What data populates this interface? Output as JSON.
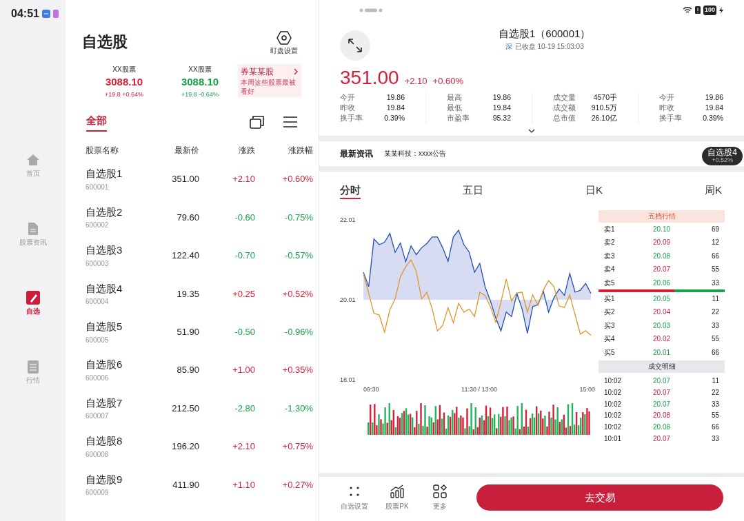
{
  "status_bar": {
    "time": "04:51",
    "battery": "100"
  },
  "sidebar": {
    "items": [
      {
        "label": "首页",
        "selected": false,
        "kind": "home"
      },
      {
        "label": "股票资讯",
        "selected": false,
        "kind": "news"
      },
      {
        "label": "自选",
        "selected": true,
        "kind": "watch"
      },
      {
        "label": "行情",
        "selected": false,
        "kind": "market"
      }
    ]
  },
  "watchlist": {
    "title": "自选股",
    "settings_label": "盯盘设置",
    "indices": [
      {
        "name": "XX股票",
        "value": "3088.10",
        "change": "+19.8 +0.64%",
        "rising": true
      },
      {
        "name": "XX股票",
        "value": "3088.10",
        "change": "+19.8 -0.64%",
        "rising": false
      }
    ],
    "promo": {
      "title": "券某某股",
      "text": "本周这些股票最被看好"
    },
    "tabs": [
      {
        "label": "全部",
        "selected": true
      }
    ],
    "columns": [
      "股票名称",
      "最新价",
      "涨跌",
      "涨跌幅"
    ],
    "rows": [
      {
        "name": "自选股1",
        "code": "600001",
        "price": "351.00",
        "change": "+2.10",
        "percent": "+0.60%",
        "rising": true
      },
      {
        "name": "自选股2",
        "code": "600002",
        "price": "79.60",
        "change": "-0.60",
        "percent": "-0.75%",
        "rising": false
      },
      {
        "name": "自选股3",
        "code": "600003",
        "price": "122.40",
        "change": "-0.70",
        "percent": "-0.57%",
        "rising": false
      },
      {
        "name": "自选股4",
        "code": "600004",
        "price": "19.35",
        "change": "+0.25",
        "percent": "+0.52%",
        "rising": true
      },
      {
        "name": "自选股5",
        "code": "600005",
        "price": "51.90",
        "change": "-0.50",
        "percent": "-0.96%",
        "rising": false
      },
      {
        "name": "自选股6",
        "code": "600006",
        "price": "85.90",
        "change": "+1.00",
        "percent": "+0.35%",
        "rising": true
      },
      {
        "name": "自选股7",
        "code": "600007",
        "price": "212.50",
        "change": "-2.80",
        "percent": "-1.30%",
        "rising": false
      },
      {
        "name": "自选股8",
        "code": "600008",
        "price": "196.20",
        "change": "+2.10",
        "percent": "+0.75%",
        "rising": true
      },
      {
        "name": "自选股9",
        "code": "600009",
        "price": "411.90",
        "change": "+1.10",
        "percent": "+0.27%",
        "rising": true
      }
    ]
  },
  "detail": {
    "title": "自选股1（600001）",
    "market": "深",
    "status": "已收盘 10-19 15:03:03",
    "price": "351.00",
    "change": "+2.10",
    "percent": "+0.60%",
    "rising": true,
    "stats": [
      [
        [
          "今开",
          "19.86"
        ],
        [
          "昨收",
          "19.84"
        ],
        [
          "换手率",
          "0.39%"
        ]
      ],
      [
        [
          "最高",
          "19.86"
        ],
        [
          "最低",
          "19.84"
        ],
        [
          "市盈率",
          "95.32"
        ]
      ],
      [
        [
          "成交量",
          "4570手"
        ],
        [
          "成交额",
          "910.5万"
        ],
        [
          "总市值",
          "26.10亿"
        ]
      ],
      [
        [
          "今开",
          "19.86"
        ],
        [
          "昨收",
          "19.84"
        ],
        [
          "换手率",
          "0.39%"
        ]
      ]
    ],
    "news": {
      "label": "最新资讯",
      "text": "某某科技：xxxx公告"
    },
    "floating": {
      "name": "自选股4",
      "percent": "+0.52%"
    },
    "chart_tabs": [
      {
        "label": "分时",
        "selected": true
      },
      {
        "label": "五日",
        "selected": false
      },
      {
        "label": "日K",
        "selected": false
      },
      {
        "label": "周K",
        "selected": false
      }
    ],
    "chart_data": {
      "type": "line",
      "ylim": [
        18.01,
        22.01
      ],
      "yticks": [
        18.01,
        20.01,
        22.01
      ],
      "series": [
        {
          "color": "#1f4fb5",
          "values": [
            20.7,
            20.34,
            21.53,
            21.39,
            21.45,
            21.67,
            21.2,
            21.43,
            20.96,
            21.36,
            21.14,
            21.31,
            21.42,
            21.58,
            21.58,
            21.31,
            20.97,
            21.58,
            21.75,
            21.39,
            21.2,
            20.7,
            20.92,
            20.34,
            19.98,
            19.56,
            19.23,
            19.7,
            19.59,
            20.17,
            19.78,
            19.17,
            19.84,
            19.89,
            20.23,
            19.7,
            20.06,
            20.28,
            20.12,
            20.67,
            20.2,
            20.25,
            20.42,
            20.17
          ]
        },
        {
          "color": "#e0962a",
          "values": [
            20.67,
            20.17,
            19.67,
            19.63,
            19.2,
            19.76,
            20.03,
            20.59,
            20.84,
            21.01,
            20.72,
            20.03,
            20.2,
            19.78,
            19.23,
            19.37,
            19.81,
            19.44,
            19.92,
            19.7,
            19.78,
            19.59,
            20.2,
            20.12,
            19.84,
            19.45,
            19.95,
            20.53,
            19.98,
            20.18,
            20.2,
            19.7,
            20.13,
            19.87,
            20.25,
            20.49,
            20.34,
            19.85,
            19.82,
            20.13,
            19.64,
            19.15,
            19.24,
            19.12
          ]
        }
      ]
    },
    "time_axis": [
      "09:30",
      "11:30 / 13:00",
      "15:00"
    ],
    "order_book": {
      "title": "五档行情",
      "level": 0.6,
      "sells": [
        {
          "label": "卖1",
          "price": "20.10",
          "volume": "69",
          "rising": false
        },
        {
          "label": "卖2",
          "price": "20.09",
          "volume": "12",
          "rising": true
        },
        {
          "label": "卖3",
          "price": "20.08",
          "volume": "66",
          "rising": false
        },
        {
          "label": "卖4",
          "price": "20.07",
          "volume": "55",
          "rising": true
        },
        {
          "label": "卖5",
          "price": "20.06",
          "volume": "33",
          "rising": false
        }
      ],
      "buys": [
        {
          "label": "买1",
          "price": "20.05",
          "volume": "11",
          "rising": false
        },
        {
          "label": "买2",
          "price": "20.04",
          "volume": "22",
          "rising": true
        },
        {
          "label": "买3",
          "price": "20.03",
          "volume": "33",
          "rising": false
        },
        {
          "label": "买4",
          "price": "20.02",
          "volume": "55",
          "rising": true
        },
        {
          "label": "买5",
          "price": "20.01",
          "volume": "66",
          "rising": false
        }
      ],
      "trades_title": "成交明细",
      "trades": [
        {
          "time": "10:02",
          "price": "20.07",
          "volume": "11",
          "rising": false
        },
        {
          "time": "10:02",
          "price": "20.07",
          "volume": "22",
          "rising": true
        },
        {
          "time": "10:02",
          "price": "20.07",
          "volume": "33",
          "rising": false
        },
        {
          "time": "10:02",
          "price": "20.08",
          "volume": "55",
          "rising": true
        },
        {
          "time": "10:02",
          "price": "20.08",
          "volume": "66",
          "rising": false
        },
        {
          "time": "10:01",
          "price": "20.07",
          "volume": "33",
          "rising": true
        }
      ]
    },
    "toolbar": [
      {
        "label": "自选设置",
        "kind": "dots"
      },
      {
        "label": "股票PK",
        "kind": "compare"
      },
      {
        "label": "更多",
        "kind": "more"
      }
    ],
    "trade_button": "去交易"
  }
}
